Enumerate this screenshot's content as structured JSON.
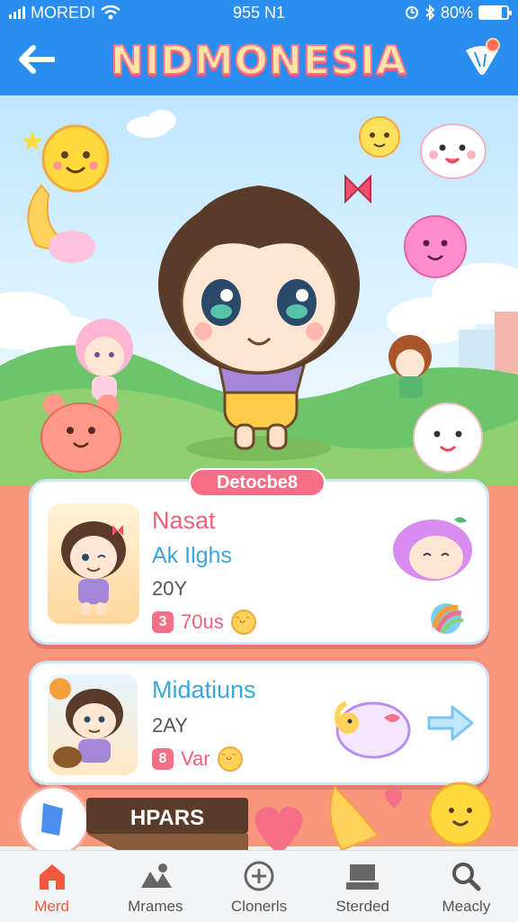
{
  "status_bar": {
    "carrier": "MOREDI",
    "time": "955 N1",
    "battery": "80%",
    "battery_level": 0.8
  },
  "header": {
    "title": "NIDMONESIA",
    "back_icon": "arrow-left-icon",
    "notification_icon": "ice-cream-notification-icon"
  },
  "section": {
    "label": "Detocbe8"
  },
  "cards": [
    {
      "title": "Nasat",
      "subtitle": "Ak Ilghs",
      "meta": "20Y",
      "badge": "3",
      "stat": "70us",
      "colors": {
        "title": "#f0607a"
      }
    },
    {
      "title": "Midatiuns",
      "meta": "2AY",
      "badge": "8",
      "stat": "Var",
      "colors": {
        "title": "#3aa6e0"
      }
    }
  ],
  "bottom_sign": "HPARS",
  "nav": {
    "items": [
      {
        "label": "Merd",
        "icon": "home-icon",
        "active": true
      },
      {
        "label": "Mrames",
        "icon": "shapes-icon",
        "active": false
      },
      {
        "label": "Clonerls",
        "icon": "add-circle-icon",
        "active": false
      },
      {
        "label": "Sterded",
        "icon": "store-icon",
        "active": false
      },
      {
        "label": "Meacly",
        "icon": "search-icon",
        "active": false
      }
    ]
  },
  "colors": {
    "primary": "#2a8ef0",
    "accent_pink": "#f56f87",
    "coral": "#f7967a",
    "active_nav": "#f05a3c"
  }
}
